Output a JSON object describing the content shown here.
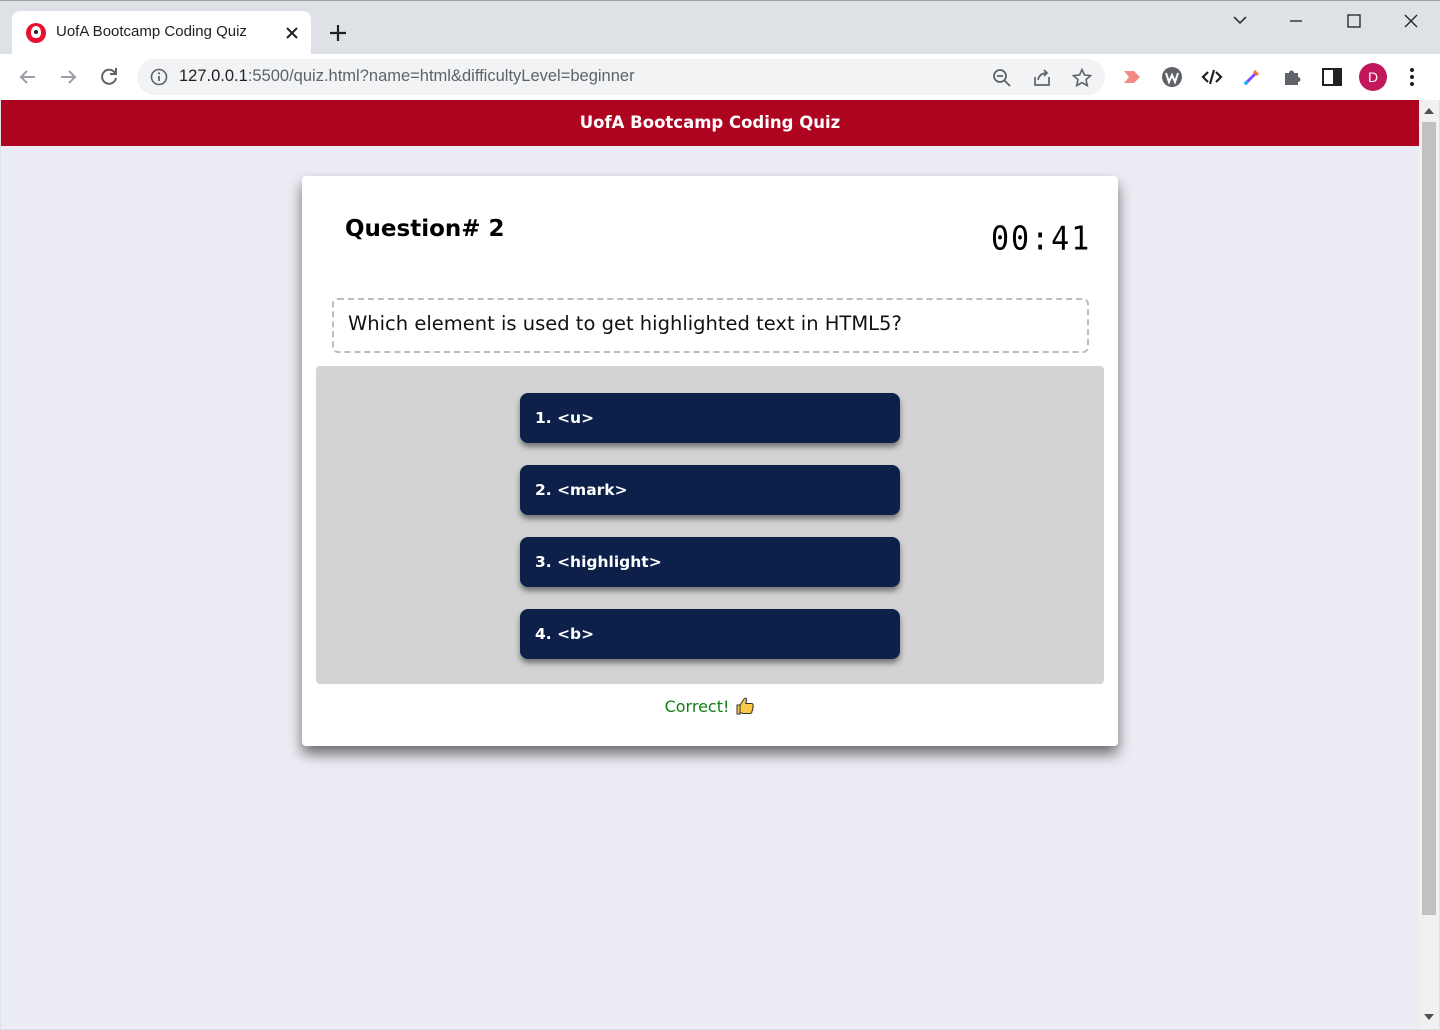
{
  "browser": {
    "tab_title": "UofA Bootcamp Coding Quiz",
    "url_host": "127.0.0.1",
    "url_rest": ":5500/quiz.html?name=html&difficultyLevel=beginner",
    "profile_initial": "D"
  },
  "page": {
    "header_title": "UofA Bootcamp Coding Quiz",
    "question_number": "Question# 2",
    "timer": "00:41",
    "question_text": "Which element is used to get highlighted text in HTML5?",
    "answers": [
      {
        "label": "1. <u>"
      },
      {
        "label": "2. <mark>"
      },
      {
        "label": "3. <highlight>"
      },
      {
        "label": "4. <b>"
      }
    ],
    "feedback": "Correct!"
  },
  "colors": {
    "header": "#ae0420",
    "answer_button": "#0d204a",
    "feedback": "#108010",
    "page_background": "#ecedf4"
  }
}
